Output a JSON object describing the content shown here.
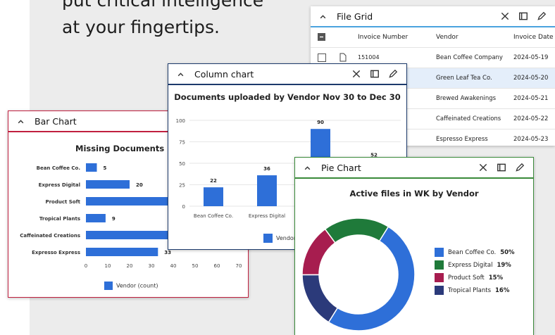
{
  "hero": {
    "line1": "put critical intelligence",
    "line2": "at your fingertips."
  },
  "colors": {
    "bar": "#2e6fd8",
    "file_grid_accent": "#4aa3df",
    "column_accent": "#1c3a6b",
    "bar_accent": "#c0203f",
    "pie_accent": "#3a8a3a"
  },
  "file_grid": {
    "title": "File Grid",
    "columns": [
      "Invoice Number",
      "Vendor",
      "Invoice Date"
    ],
    "rows": [
      {
        "invoice": "151004",
        "vendor": "Bean Coffee Company",
        "date": "2024-05-19"
      },
      {
        "invoice": "",
        "vendor": "Green Leaf Tea Co.",
        "date": "2024-05-20"
      },
      {
        "invoice": "",
        "vendor": "Brewed Awakenings",
        "date": "2024-05-21"
      },
      {
        "invoice": "",
        "vendor": "Caffeinated Creations",
        "date": "2024-05-22"
      },
      {
        "invoice": "",
        "vendor": "Espresso Express",
        "date": "2024-05-23"
      }
    ]
  },
  "column_window": {
    "title": "Column chart",
    "legend": "Vendor"
  },
  "bar_window": {
    "title": "Bar Chart",
    "legend": "Vendor (count)"
  },
  "pie_window": {
    "title": "Pie Chart"
  },
  "chart_data": [
    {
      "type": "bar",
      "title": "Documents uploaded by Vendor Nov 30 to Dec 30",
      "categories": [
        "Bean Coffee Co.",
        "Express Digital",
        "",
        ""
      ],
      "values": [
        22,
        36,
        90,
        52
      ],
      "ylim": [
        0,
        100
      ],
      "yticks": [
        0,
        25,
        50,
        75,
        100
      ],
      "legend": [
        "Vendor"
      ]
    },
    {
      "type": "bar",
      "orientation": "horizontal",
      "title": "Missing Documents by Vendor",
      "title_visible": "Missing Documents by Ver",
      "categories": [
        "Bean Coffee Co.",
        "Express Digital",
        "Product Soft",
        "Tropical Plants",
        "Caffeinated Creations",
        "Expresso Express"
      ],
      "values": [
        5,
        20,
        38,
        9,
        38,
        33
      ],
      "labels": [
        "5",
        "20",
        "",
        "9",
        "",
        "33"
      ],
      "xlim": [
        0,
        70
      ],
      "xticks": [
        0,
        10,
        20,
        30,
        40,
        50,
        60,
        70
      ],
      "legend": [
        "Vendor (count)"
      ]
    },
    {
      "type": "pie",
      "title": "Active files in WK by Vendor",
      "categories": [
        "Bean Coffee Co.",
        "Express Digital",
        "Product Soft",
        "Tropical Plants"
      ],
      "values": [
        50,
        19,
        15,
        16
      ],
      "labels": [
        "50%",
        "19%",
        "15%",
        "16%"
      ],
      "colors": [
        "#2e6fd8",
        "#1f7a3a",
        "#a71d4f",
        "#2b3a7a"
      ]
    }
  ]
}
